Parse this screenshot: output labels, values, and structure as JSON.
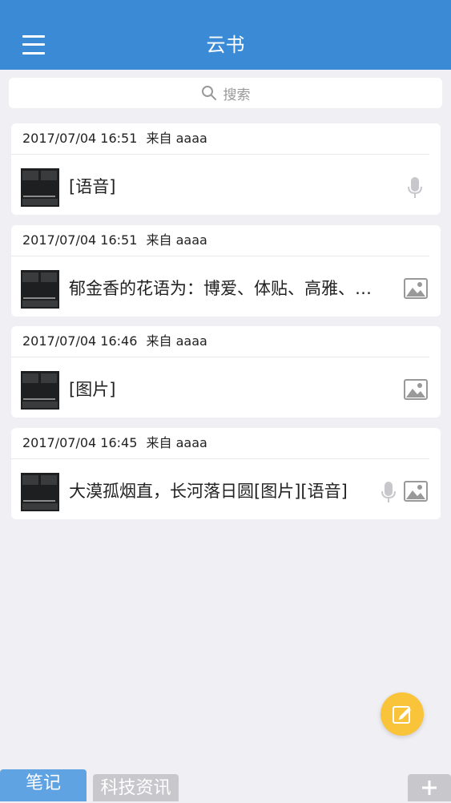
{
  "header": {
    "title": "云书"
  },
  "search": {
    "placeholder": "搜索"
  },
  "notes": [
    {
      "date": "2017/07/04 16:51",
      "from": "来自 aaaa",
      "content": "[语音]",
      "icons": [
        "microphone-icon"
      ]
    },
    {
      "date": "2017/07/04 16:51",
      "from": "来自 aaaa",
      "content": "郁金香的花语为：博爱、体贴、高雅、…",
      "icons": [
        "image-icon"
      ]
    },
    {
      "date": "2017/07/04 16:46",
      "from": "来自 aaaa",
      "content": "[图片]",
      "icons": [
        "image-icon"
      ]
    },
    {
      "date": "2017/07/04 16:45",
      "from": "来自 aaaa",
      "content": "大漠孤烟直，长河落日圆[图片][语音]",
      "icons": [
        "microphone-icon",
        "image-icon"
      ]
    }
  ],
  "tabs": [
    {
      "label": "笔记",
      "active": true
    },
    {
      "label": "科技资讯",
      "active": false
    }
  ],
  "colors": {
    "nav": "#3a8ad6",
    "fab": "#f9c43a",
    "active_tab": "#5fa3e3",
    "inactive_tab": "#c8c8cc"
  }
}
